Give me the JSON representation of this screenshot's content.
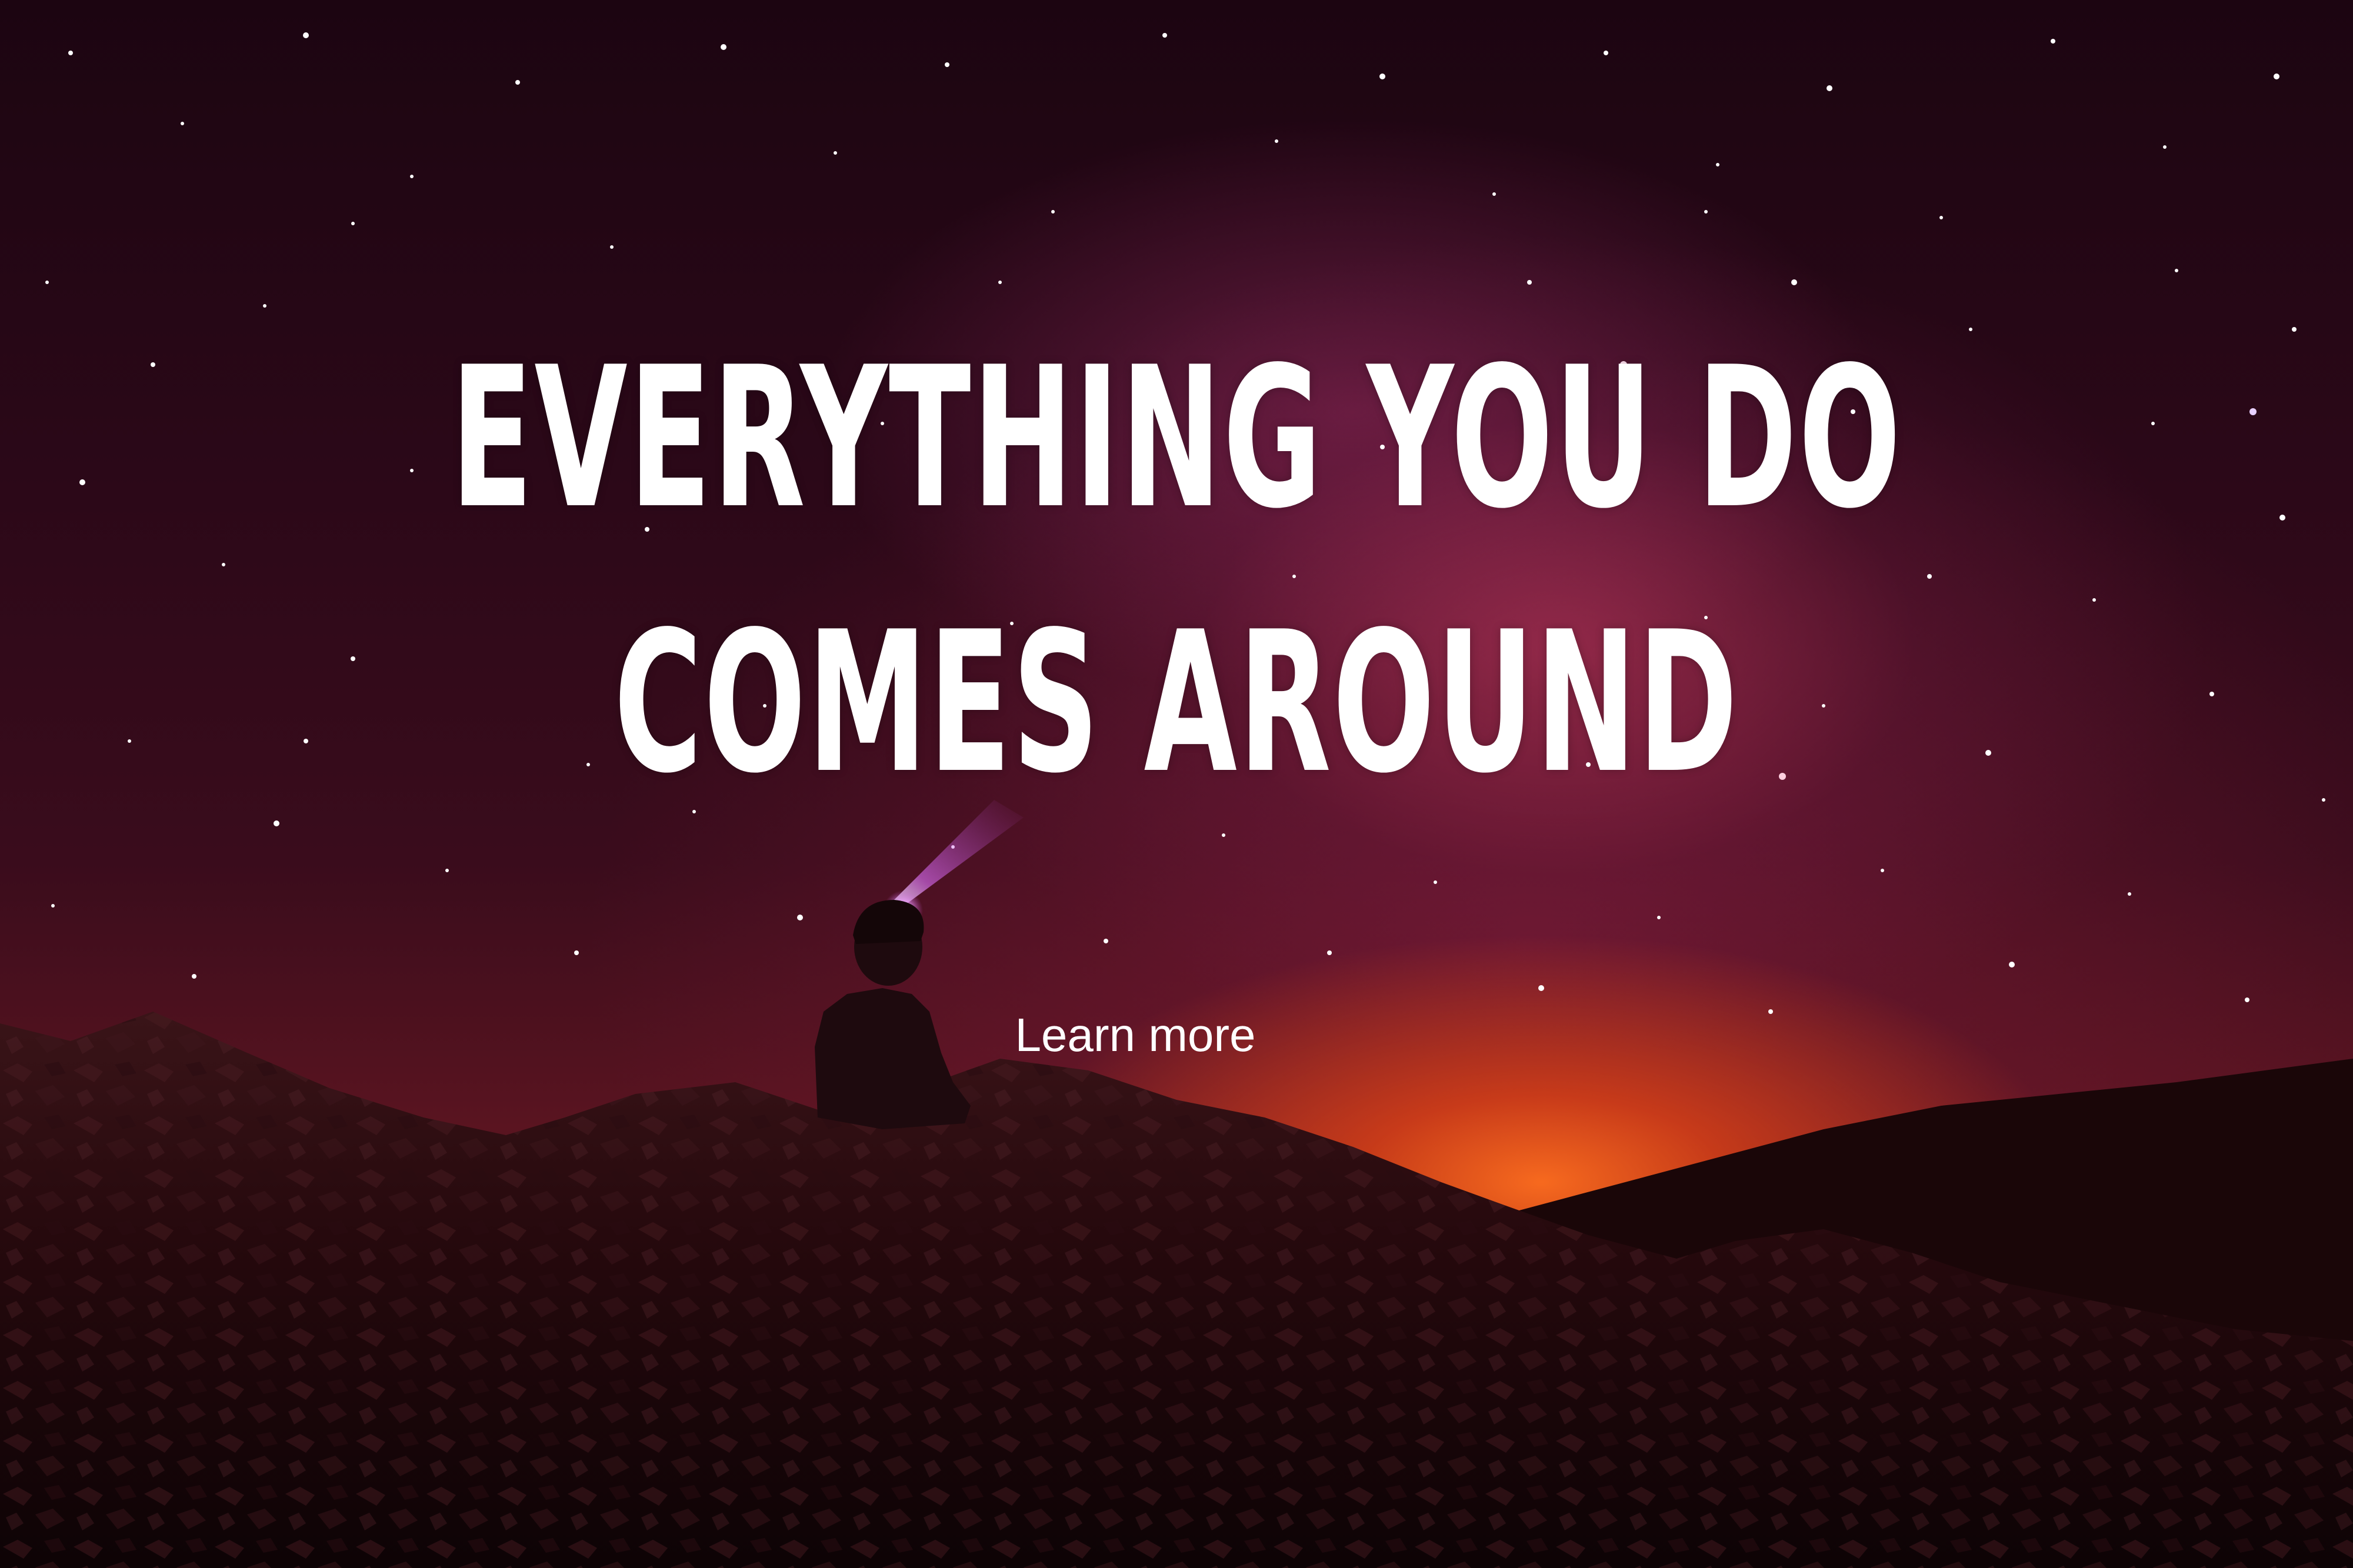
{
  "hero": {
    "headline_line1": "EVERYTHING YOU DO",
    "headline_line2": "COMES AROUND",
    "cta_label": "Learn more"
  },
  "background": {
    "subject": "starry-night-sky",
    "colors": {
      "sky_top": "#1c0511",
      "milky_way": "#c83c64",
      "horizon_glow": "#ff6e1e",
      "foreground": "#120407"
    }
  }
}
